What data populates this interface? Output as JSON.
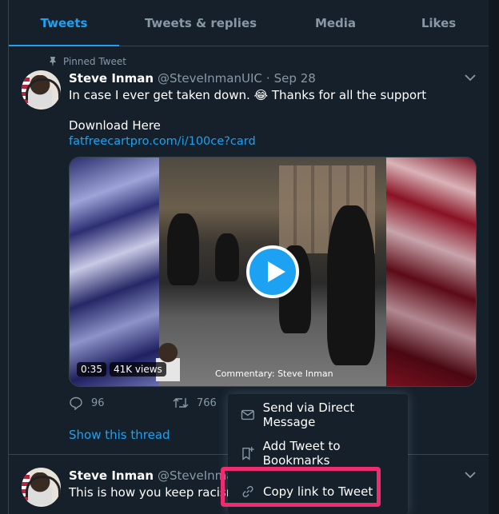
{
  "tabs": [
    {
      "label": "Tweets",
      "active": true
    },
    {
      "label": "Tweets & replies",
      "active": false
    },
    {
      "label": "Media",
      "active": false
    },
    {
      "label": "Likes",
      "active": false
    }
  ],
  "pinned_label": "Pinned Tweet",
  "tweet1": {
    "name": "Steve Inman",
    "handle": "@SteveInmanUIC",
    "separator": "·",
    "date": "Sep 28",
    "text": "In case I ever get taken down. 😂 Thanks for all the support",
    "download": "Download Here",
    "link": "fatfreecartpro.com/i/100ce?card",
    "video": {
      "duration": "0:35",
      "views": "41K views",
      "commentary": "Commentary: Steve Inman"
    },
    "replies": "96",
    "retweets": "766",
    "show_thread": "Show this thread"
  },
  "tweet2": {
    "name": "Steve Inman",
    "handle": "@SteveInmanUI",
    "text": "This is how you keep racism a"
  },
  "menu": {
    "items": [
      {
        "label": "Send via Direct Message",
        "icon": "envelope-icon"
      },
      {
        "label": "Add Tweet to Bookmarks",
        "icon": "bookmark-add-icon"
      },
      {
        "label": "Copy link to Tweet",
        "icon": "link-icon"
      }
    ]
  },
  "colors": {
    "background": "#15202b",
    "accent": "#1da1f2",
    "muted": "#8899a6",
    "highlight": "#ef2c6f"
  }
}
